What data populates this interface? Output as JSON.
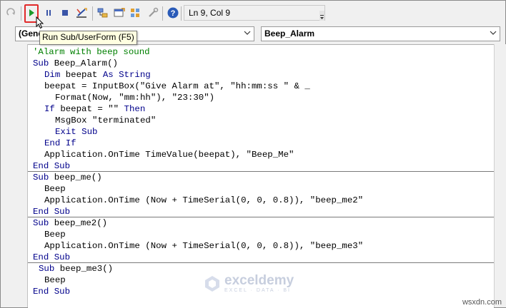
{
  "toolbar": {
    "status_text": "Ln 9, Col 9",
    "buttons": [
      "redo-icon",
      "run-icon",
      "break-icon",
      "reset-icon",
      "design-mode-icon",
      "project-explorer-icon",
      "properties-icon",
      "object-browser-icon",
      "toolbox-icon",
      "help-icon"
    ]
  },
  "tooltip": "Run Sub/UserForm (F5)",
  "object_combo": "(General)",
  "object_combo_visible": "(Gene",
  "procedure_combo": "Beep_Alarm",
  "code": {
    "line1": "'Alarm with beep sound",
    "line2_kw": "Sub ",
    "line2_rest": "Beep_Alarm()",
    "line3_kw1": "Dim ",
    "line3_mid": "beepat ",
    "line3_kw2": "As String",
    "line4": "beepat = InputBox(\"Give Alarm at\", \"hh:mm:ss \" & _",
    "line5": "Format(Now, \"mm:hh\"), \"23:30\")",
    "line6_kw1": "If ",
    "line6_mid": "beepat = \"\" ",
    "line6_kw2": "Then",
    "line7": "MsgBox \"terminated\"",
    "line8": "Exit Sub",
    "line9": "End If",
    "line10": "Application.OnTime TimeValue(beepat), \"Beep_Me\"",
    "line11": "End Sub",
    "line12_kw": "Sub ",
    "line12_rest": "beep_me()",
    "line13": "Beep",
    "line14": "Application.OnTime (Now + TimeSerial(0, 0, 0.8)), \"beep_me2\"",
    "line15": "End Sub",
    "line16_kw": "Sub ",
    "line16_rest": "beep_me2()",
    "line17": "Beep",
    "line18": "Application.OnTime (Now + TimeSerial(0, 0, 0.8)), \"beep_me3\"",
    "line19": "End Sub",
    "line20_kw": "Sub ",
    "line20_rest": "beep_me3()",
    "line21": "Beep",
    "line22": "End Sub"
  },
  "watermark": {
    "title": "exceldemy",
    "subtitle": "EXCEL · DATA · BI"
  },
  "credit": "wsxdn.com",
  "colors": {
    "comment": "#008000",
    "keyword": "#00008b",
    "highlight": "#e12a2a",
    "tooltip_bg": "#ffffe1"
  }
}
